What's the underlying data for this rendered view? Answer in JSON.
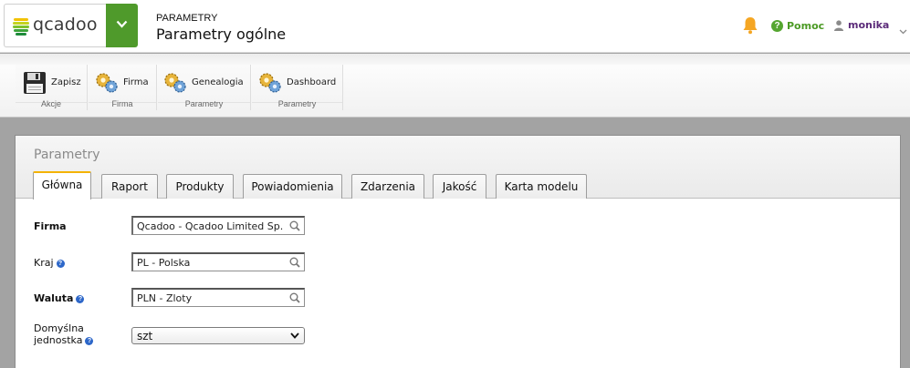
{
  "header": {
    "logo_text": "qcadoo",
    "breadcrumb_small": "PARAMETRY",
    "breadcrumb_big": "Parametry ogólne",
    "help_label": "Pomoc",
    "user_name": "monika",
    "icons": [
      "logo-mark-icon",
      "chevron-down-icon",
      "bell-icon",
      "help-icon",
      "user-icon",
      "caret-down-icon"
    ]
  },
  "ribbon": {
    "groups": [
      {
        "label": "Akcje",
        "buttons": [
          {
            "label": "Zapisz",
            "icon": "floppy-disk-icon"
          }
        ]
      },
      {
        "label": "Firma",
        "buttons": [
          {
            "label": "Firma",
            "icon": "gears-icon"
          }
        ]
      },
      {
        "label": "Parametry",
        "buttons": [
          {
            "label": "Genealogia",
            "icon": "gears-icon"
          }
        ]
      },
      {
        "label": "Parametry",
        "buttons": [
          {
            "label": "Dashboard",
            "icon": "gears-icon"
          }
        ]
      }
    ]
  },
  "panel": {
    "title": "Parametry",
    "tabs": [
      {
        "label": "Główna",
        "active": true
      },
      {
        "label": "Raport",
        "active": false
      },
      {
        "label": "Produkty",
        "active": false
      },
      {
        "label": "Powiadomienia",
        "active": false
      },
      {
        "label": "Zdarzenia",
        "active": false
      },
      {
        "label": "Jakość",
        "active": false
      },
      {
        "label": "Karta modelu",
        "active": false
      }
    ],
    "fields": {
      "firma": {
        "label": "Firma",
        "value": "Qcadoo - Qcadoo Limited Sp."
      },
      "kraj": {
        "label": "Kraj",
        "value": "PL - Polska"
      },
      "waluta": {
        "label": "Waluta",
        "value": "PLN - Zloty"
      },
      "jednostka": {
        "label_line1": "Domyślna",
        "label_line2": "jednostka",
        "value": "szt"
      }
    }
  },
  "colors": {
    "accent_green": "#4f9a2b",
    "bell_orange": "#f5a623",
    "help_green": "#55a630",
    "user_purple": "#5b2a79",
    "active_tab_border": "#f4b300",
    "info_blue": "#2d67c9"
  }
}
